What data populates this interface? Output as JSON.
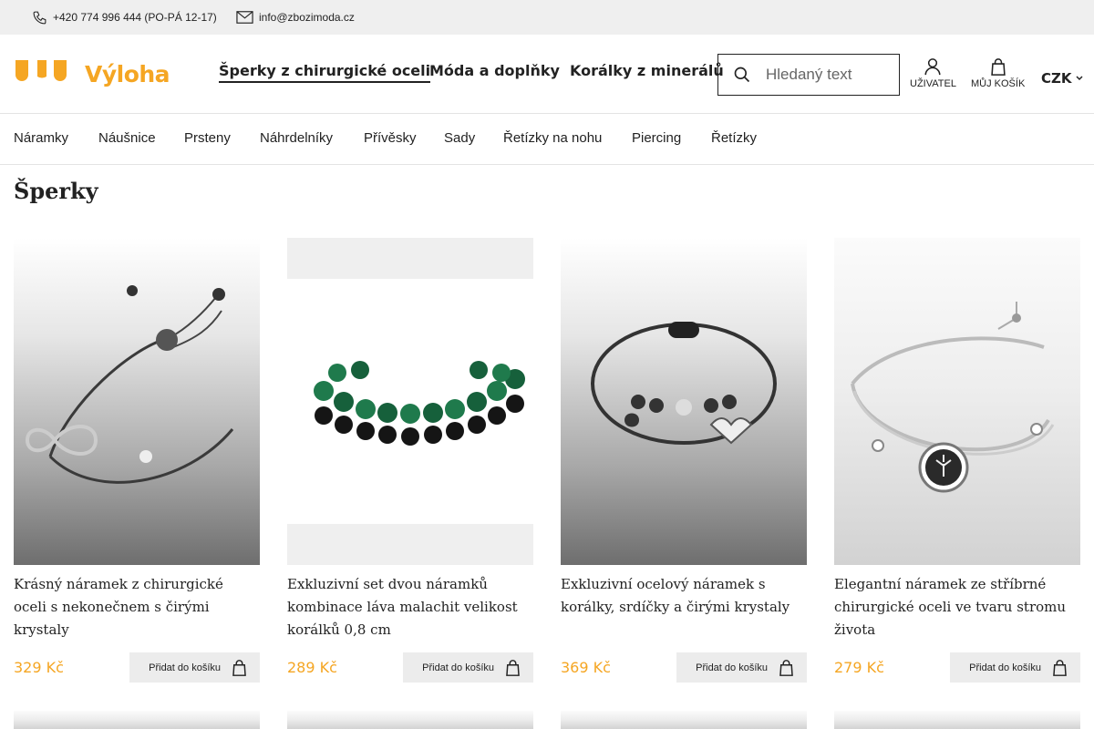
{
  "topbar": {
    "phone": "+420 774 996 444 (PO-PÁ 12-17)",
    "email": "info@zbozimoda.cz"
  },
  "header": {
    "logo": "Výloha",
    "nav": [
      "Šperky z chirurgické oceli",
      "Móda a doplňky",
      "Korálky z minerálů"
    ],
    "active_nav_index": 0,
    "search_placeholder": "Hledaný text",
    "user_label": "Uživatel",
    "cart_label": "Můj košík",
    "currency": "CZK"
  },
  "categories": [
    "Náramky",
    "Náušnice",
    "Prsteny",
    "Náhrdelníky",
    "Přívěsky",
    "Sady",
    "Řetízky na nohu",
    "Piercing",
    "Řetízky"
  ],
  "page_title": "Šperky",
  "add_to_cart_label": "Přidat do košíku",
  "products": [
    {
      "name": "Krásný náramek z chirurgické oceli s nekonečnem s čirými krystaly",
      "price": "329 Kč"
    },
    {
      "name": "Exkluzivní set dvou náramků kombinace láva malachit velikost korálků 0,8 cm",
      "price": "289 Kč"
    },
    {
      "name": "Exkluzivní ocelový náramek s korálky, srdíčky a čirými krystaly",
      "price": "369 Kč"
    },
    {
      "name": "Elegantní náramek ze stříbrné chirurgické oceli ve tvaru stromu života",
      "price": "279 Kč"
    }
  ],
  "colors": {
    "accent": "#f5a623",
    "topbar_bg": "#efefef",
    "button_bg": "#ececec",
    "malachite": "#1f7a4c"
  }
}
